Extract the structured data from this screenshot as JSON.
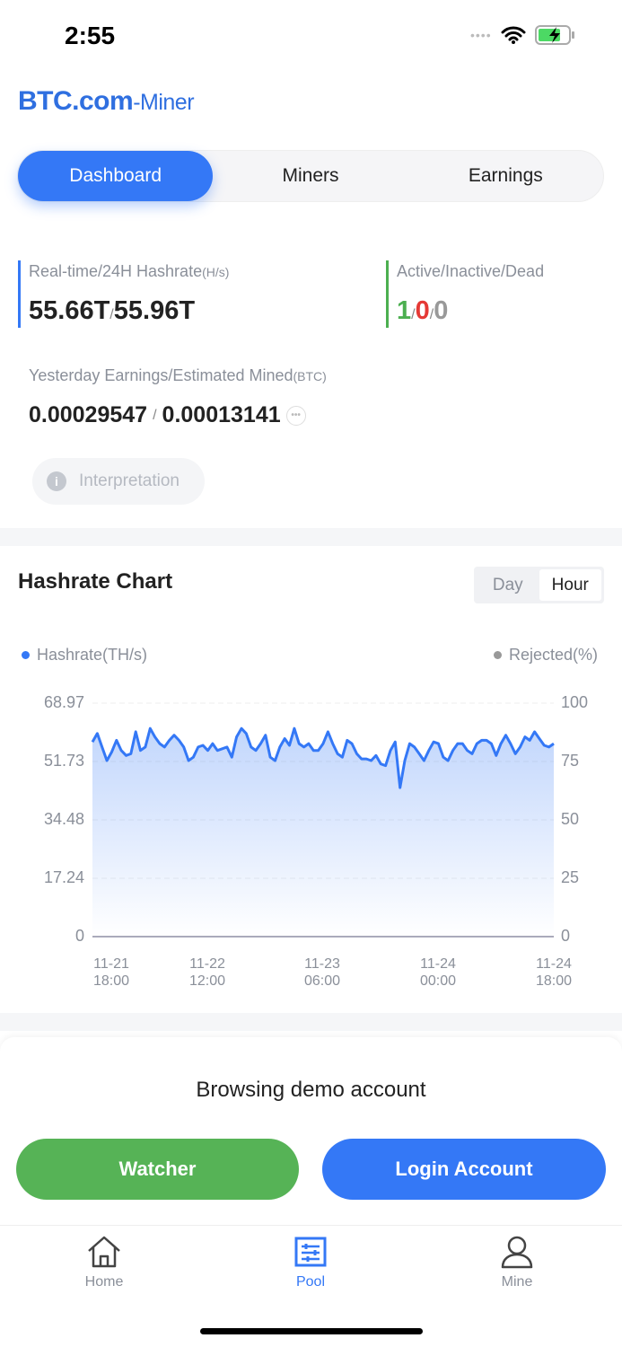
{
  "status": {
    "time": "2:55"
  },
  "brand": {
    "logo": "BTC.com",
    "sub": "-Miner"
  },
  "tabs": [
    "Dashboard",
    "Miners",
    "Earnings"
  ],
  "stats": {
    "hashrate_label": "Real-time/24H Hashrate",
    "hashrate_unit": "(H/s)",
    "realtime": "55.66T",
    "h24": "55.96T",
    "workers_label": "Active/Inactive/Dead",
    "active": "1",
    "inactive": "0",
    "dead": "0",
    "earnings_label": "Yesterday Earnings/Estimated Mined",
    "earnings_unit": "(BTC)",
    "yesterday": "0.00029547",
    "estimated": "0.00013141",
    "interpretation": "Interpretation",
    "slash": "/"
  },
  "chart_section": {
    "title": "Hashrate Chart",
    "toggle": [
      "Day",
      "Hour"
    ],
    "selected": "Hour"
  },
  "chart_data": {
    "type": "area",
    "legend_left": "Hashrate(TH/s)",
    "legend_right": "Rejected(%)",
    "y_left_ticks": [
      "68.97",
      "51.73",
      "34.48",
      "17.24",
      "0"
    ],
    "y_right_ticks": [
      "100",
      "75",
      "50",
      "25",
      "0"
    ],
    "ylim_left": [
      0,
      68.97
    ],
    "ylim_right": [
      0,
      100
    ],
    "x_ticks": [
      [
        "11-21",
        "18:00"
      ],
      [
        "11-22",
        "12:00"
      ],
      [
        "11-23",
        "06:00"
      ],
      [
        "11-24",
        "00:00"
      ],
      [
        "11-24",
        "18:00"
      ]
    ],
    "series": [
      {
        "name": "Hashrate(TH/s)",
        "color": "#3478f6",
        "values": [
          57.5,
          60,
          56,
          52,
          54.5,
          58,
          55,
          53.5,
          54,
          60.5,
          55,
          56,
          61.5,
          59,
          57,
          56,
          58,
          59.5,
          58,
          56,
          52,
          53,
          56,
          56.5,
          55,
          57,
          55,
          55.5,
          56,
          53,
          59,
          61.5,
          60,
          56,
          55,
          57,
          59.5,
          53,
          52,
          56,
          58.5,
          56.5,
          61.5,
          57,
          56,
          57,
          55,
          55,
          57,
          60.5,
          57,
          54,
          53,
          58,
          57,
          54,
          52.5,
          52.5,
          52,
          53.5,
          51,
          50.5,
          55,
          57.5,
          44,
          52,
          57,
          56,
          54,
          52,
          55,
          57.5,
          57,
          53,
          52,
          55,
          57,
          57,
          55,
          54,
          57,
          58,
          58,
          57,
          53.5,
          57,
          59.5,
          57,
          54,
          56,
          59,
          58,
          60.5,
          58.5,
          56.5,
          56,
          57
        ]
      }
    ]
  },
  "banner": {
    "text": "Browsing demo account",
    "watcher": "Watcher",
    "login": "Login Account"
  },
  "nav": [
    {
      "label": "Home",
      "icon": "home-icon"
    },
    {
      "label": "Pool",
      "icon": "pool-icon"
    },
    {
      "label": "Mine",
      "icon": "user-icon"
    }
  ],
  "colors": {
    "accent": "#3478f6",
    "green": "#4caf50",
    "red": "#e53935"
  }
}
